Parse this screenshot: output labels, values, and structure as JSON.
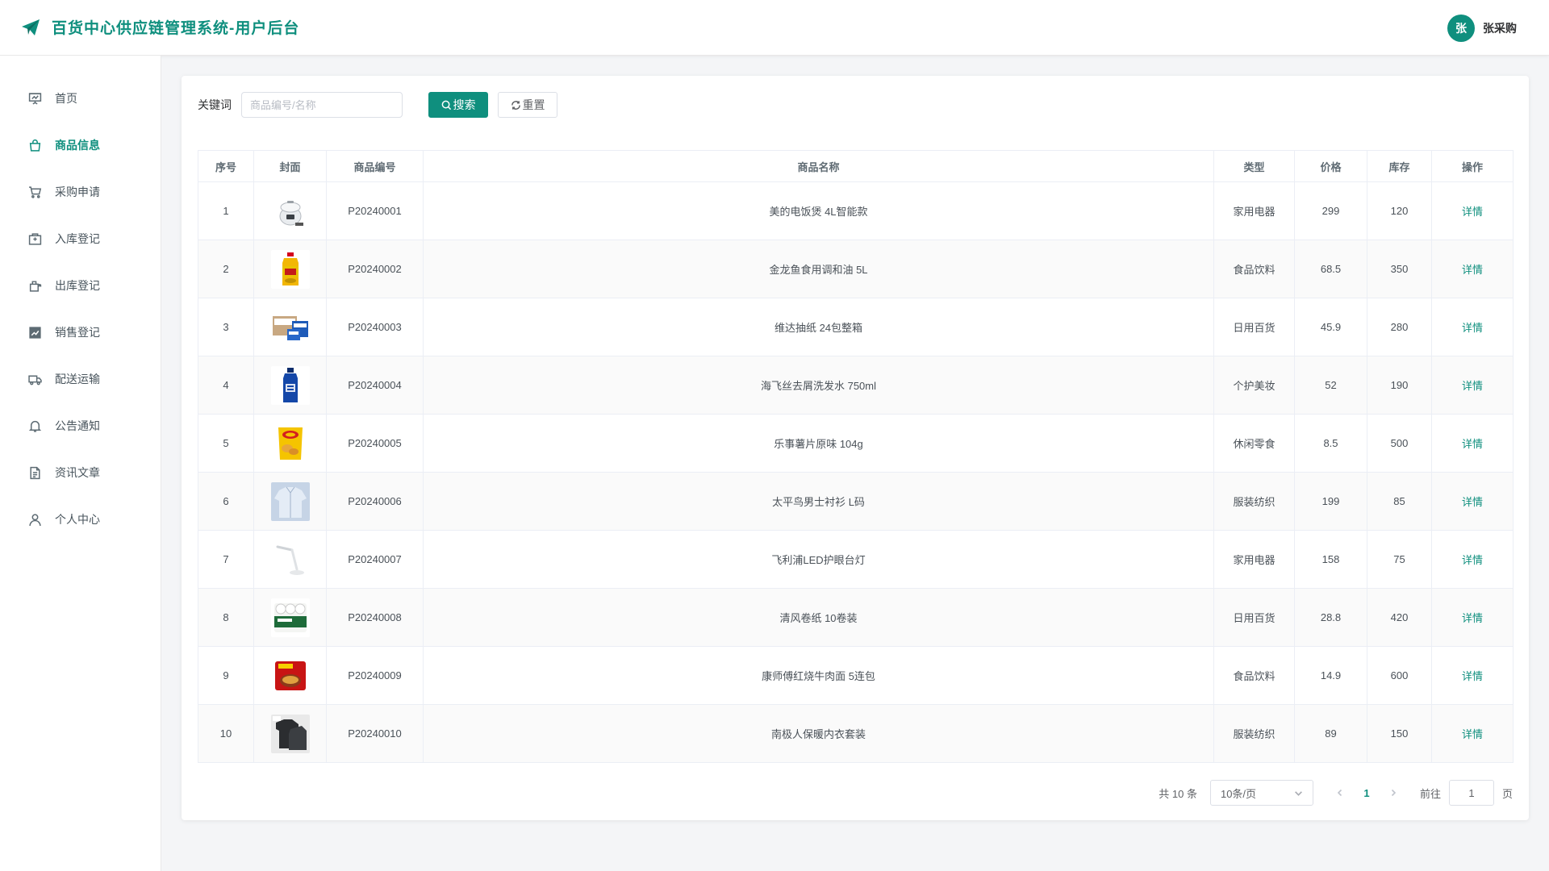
{
  "header": {
    "title": "百货中心供应链管理系统-用户后台",
    "avatar_char": "张",
    "user_name": "张采购",
    "accent": "#0f8f7e"
  },
  "sidebar": {
    "items": [
      {
        "label": "首页",
        "icon": "presentation-icon",
        "active": false
      },
      {
        "label": "商品信息",
        "icon": "shopping-bag-icon",
        "active": true
      },
      {
        "label": "采购申请",
        "icon": "cart-icon",
        "active": false
      },
      {
        "label": "入库登记",
        "icon": "box-in-icon",
        "active": false
      },
      {
        "label": "出库登记",
        "icon": "box-out-icon",
        "active": false
      },
      {
        "label": "销售登记",
        "icon": "trend-chart-icon",
        "active": false
      },
      {
        "label": "配送运输",
        "icon": "truck-icon",
        "active": false
      },
      {
        "label": "公告通知",
        "icon": "bell-icon",
        "active": false
      },
      {
        "label": "资讯文章",
        "icon": "document-icon",
        "active": false
      },
      {
        "label": "个人中心",
        "icon": "user-icon",
        "active": false
      }
    ]
  },
  "search": {
    "label": "关键词",
    "placeholder": "商品编号/名称",
    "value": "",
    "search_label": "搜索",
    "reset_label": "重置"
  },
  "table": {
    "columns": [
      "序号",
      "封面",
      "商品编号",
      "商品名称",
      "类型",
      "价格",
      "库存",
      "操作"
    ],
    "action_label": "详情",
    "rows": [
      {
        "index": "1",
        "code": "P20240001",
        "name": "美的电饭煲 4L智能款",
        "type": "家用电器",
        "price": "299",
        "stock": "120",
        "cover": "rice-cooker"
      },
      {
        "index": "2",
        "code": "P20240002",
        "name": "金龙鱼食用调和油 5L",
        "type": "食品饮料",
        "price": "68.5",
        "stock": "350",
        "cover": "oil-bottle"
      },
      {
        "index": "3",
        "code": "P20240003",
        "name": "维达抽纸 24包整箱",
        "type": "日用百货",
        "price": "45.9",
        "stock": "280",
        "cover": "tissue-box"
      },
      {
        "index": "4",
        "code": "P20240004",
        "name": "海飞丝去屑洗发水 750ml",
        "type": "个护美妆",
        "price": "52",
        "stock": "190",
        "cover": "shampoo"
      },
      {
        "index": "5",
        "code": "P20240005",
        "name": "乐事薯片原味 104g",
        "type": "休闲零食",
        "price": "8.5",
        "stock": "500",
        "cover": "chips"
      },
      {
        "index": "6",
        "code": "P20240006",
        "name": "太平鸟男士衬衫 L码",
        "type": "服装纺织",
        "price": "199",
        "stock": "85",
        "cover": "shirt"
      },
      {
        "index": "7",
        "code": "P20240007",
        "name": "飞利浦LED护眼台灯",
        "type": "家用电器",
        "price": "158",
        "stock": "75",
        "cover": "desk-lamp"
      },
      {
        "index": "8",
        "code": "P20240008",
        "name": "清风卷纸 10卷装",
        "type": "日用百货",
        "price": "28.8",
        "stock": "420",
        "cover": "toilet-paper"
      },
      {
        "index": "9",
        "code": "P20240009",
        "name": "康师傅红烧牛肉面 5连包",
        "type": "食品饮料",
        "price": "14.9",
        "stock": "600",
        "cover": "noodles"
      },
      {
        "index": "10",
        "code": "P20240010",
        "name": "南极人保暖内衣套装",
        "type": "服装纺织",
        "price": "89",
        "stock": "150",
        "cover": "thermal-wear"
      }
    ]
  },
  "pagination": {
    "total_text": "共 10 条",
    "page_size": "10条/页",
    "current_page": "1",
    "goto_label": "前往",
    "goto_value": "1",
    "page_suffix": "页"
  }
}
